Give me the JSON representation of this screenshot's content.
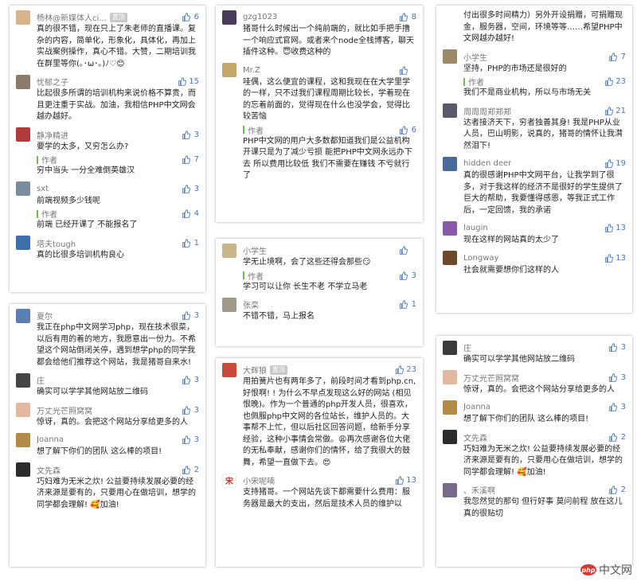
{
  "author_label": "作者",
  "badge_label": "置顶",
  "columns": [
    {
      "cards": [
        {
          "comments": [
            {
              "avatar_color": "#d9b38c",
              "name": "杨林@新媒体人ci...",
              "badge": true,
              "likes": "6",
              "text": "真的很不错，现在只上了朱老师的直播课。复杂的内容，简单化，形象化，具体化，再加上实战案例操作，真心不错。大赞，二期培训我在群里等你(｡･ω･｡)ﾉ♡😊"
            },
            {
              "avatar_color": "#8a7c6a",
              "name": "忧郁之子",
              "likes": "15",
              "text": "比起很多所谓的培训机构来说价格不算贵，而且更注重于实战。加油，我相信PHP中文网会越办越好。"
            },
            {
              "avatar_color": "#b23b3b",
              "name": "静净精进",
              "likes": "3",
              "text": "要学的太多，又穷怎么办?",
              "reply": {
                "likes": "7",
                "text": "穷中当头 一分全难倒英雄汉"
              }
            },
            {
              "avatar_color": "#7a8d9c",
              "name": "sxt",
              "likes": "3",
              "text": "前端视频多少钱呢",
              "reply": {
                "likes": "4",
                "text": "前端 已经开课了 不能报名了"
              }
            },
            {
              "avatar_color": "#3f6fa8",
              "name": "塔夫tough",
              "likes": "1",
              "text": "真的比很多培训机构良心"
            }
          ]
        },
        {
          "comments": [
            {
              "avatar_color": "#5b7fb0",
              "name": "夏尔",
              "likes": "3",
              "text": "我正在php中文网学习php，现在技术很菜，以后有用的着的地方，我愿意出一份力。不希望这个网站倒闭关停，遇到想学php的同学我都会给他们推荐这个网站，我是猪哥自来水!"
            },
            {
              "avatar_color": "#444444",
              "name": "庄",
              "likes": "3",
              "text": "确实可以学学其他网站放二维码"
            },
            {
              "avatar_color": "#e3b8a0",
              "name": "万丈光芒照窝窝",
              "likes": "3",
              "text": "惊讶，真的。会把这个网站分享给更多的人"
            },
            {
              "avatar_color": "#b38a4a",
              "name": "Joanna",
              "likes": "3",
              "text": "想了解下你们的团队 这么棒的项目!"
            },
            {
              "avatar_color": "#2c2c2c",
              "name": "文先森",
              "likes": "2",
              "text": "巧妇难为无米之炊! 公益要持续发展必要的经济来源是要有的，只要用心在做培训，想学的同学都会理解! 🥰加油!"
            }
          ]
        }
      ]
    },
    {
      "cards": [
        {
          "comments": [
            {
              "avatar_color": "#4a3b5c",
              "name": "gzg1023",
              "likes": "8",
              "text": "猪哥什么时候出一个纯前端的，就比如手把手撸一个响应式官网。或者来个node全栈博客，聊天插件这种。😇收费这种的"
            },
            {
              "avatar_color": "#c4a96a",
              "name": "Mr.Z",
              "likes": "",
              "text": "哇偶，这么便宜的课程，这和我现在在大学里学的一样，只不过我们课程周期比较长，学着现在的忘着前面的，觉得现在什么也没学会，觉得比较苦恼",
              "reply": {
                "likes": "6",
                "text": "PHP中文网的用户大多数都知道我们是公益机构 开课只是为了减少亏损 能把PHP中文网永远办下去 所以费用比较低 我们不需要在赚钱 不亏就行了"
              }
            }
          ]
        },
        {
          "comments": [
            {
              "avatar_color": "#c9b58a",
              "name": "小学生",
              "likes": "",
              "text": "学无止境啊，会了这些还得会那些😏",
              "reply": {
                "likes": "3",
                "text": "学习可以让你 长生不老 不学立马老"
              }
            },
            {
              "avatar_color": "#a09a8a",
              "name": "张栾",
              "likes": "1",
              "text": "不错不错，马上报名"
            }
          ]
        },
        {
          "comments": [
            {
              "avatar_color": "#c84a3a",
              "name": "大辉狼",
              "badge": true,
              "likes": "23",
              "text": "用拍簧片也有两年多了，前段时间才看到php.cn,好恨啊! ! 为什么不早点发现这么好的网站 (相见恨晚)。作为一个普通的php开发人员，很喜欢，也佩服php中文网的各位站长，维护人员的。大事帮不上忙，但以后社区回答问题，给新手分享经验，这种小事情会常做。😩再次感谢各位大佬的无私奉献，感谢你们的情怀，给了我很大的鼓舞，希望一直做下去。😍"
            },
            {
              "avatar_color": "#ffffff",
              "avatar_text": "宋",
              "name": "小宋呢喃",
              "likes": "13",
              "text": "支持猪哥。一个网站先谈下都需要什么费用：服务器是最大的支出，然后是技术人员的维护以"
            }
          ]
        }
      ]
    },
    {
      "cards": [
        {
          "comments": [
            {
              "continuation": true,
              "text": "付出很多时间精力）另外开设捐赠，可捐赠现金，服务器，空间，环境等等……希望PHP中文网越办越好!"
            },
            {
              "avatar_color": "#9a8a6a",
              "name": "小学生",
              "likes": "7",
              "text": "坚持，PHP的市场还是很好的",
              "reply": {
                "likes": "23",
                "text": "我们不是商业机构，所以与市场无关"
              }
            },
            {
              "avatar_color": "#5a5a6a",
              "name": "周周周郑郑郑",
              "likes": "21",
              "text": "达者接济天下，穷者独善其身! 我是PHP从业人员，巴山明影，说真的，猪哥的情怀让我潸然泪下!"
            },
            {
              "avatar_color": "#4a6a9a",
              "name": "hidden deer",
              "likes": "19",
              "text": "真的很感谢PHP中文网平台，让我学到了很多，对于我这样的经济不是很好的学生提供了巨大的帮助，我要懂得感恩，等我正式工作后，一定回馈，我的承诺"
            },
            {
              "avatar_color": "#8a5aa8",
              "name": "laugin",
              "likes": "13",
              "text": "现在这样的网站真的太少了"
            },
            {
              "avatar_color": "#6a4a2a",
              "name": "Longway",
              "likes": "13",
              "text": "社会就需要想你们这样的人"
            }
          ]
        },
        {
          "comments": [
            {
              "avatar_color": "#3a3a3a",
              "name": "庄",
              "likes": "3",
              "text": "确实可以学学其他网站放二维码"
            },
            {
              "avatar_color": "#e3b8a0",
              "name": "万丈光芒照窝窝",
              "likes": "3",
              "text": "惊讶，真的。会把这个网站分享给更多的人"
            },
            {
              "avatar_color": "#b38a4a",
              "name": "Joanna",
              "likes": "3",
              "text": "想了解下你们的团队 这么棒的项目!"
            },
            {
              "avatar_color": "#2c2c2c",
              "name": "文先森",
              "likes": "2",
              "text": "巧妇难为无米之炊! 公益要持续发展必要的经济来源是要有的，只要用心在做培训，想学的同学都会理解! 🥰加油!"
            },
            {
              "avatar_color": "#7a6a8a",
              "name": "、禾溪啊",
              "likes": "2",
              "text": "我忽然觉的那句 但行好事 莫问前程 放在这儿真的很贴切"
            }
          ]
        }
      ]
    }
  ],
  "logo": {
    "mark": "php",
    "text": "中文网"
  }
}
